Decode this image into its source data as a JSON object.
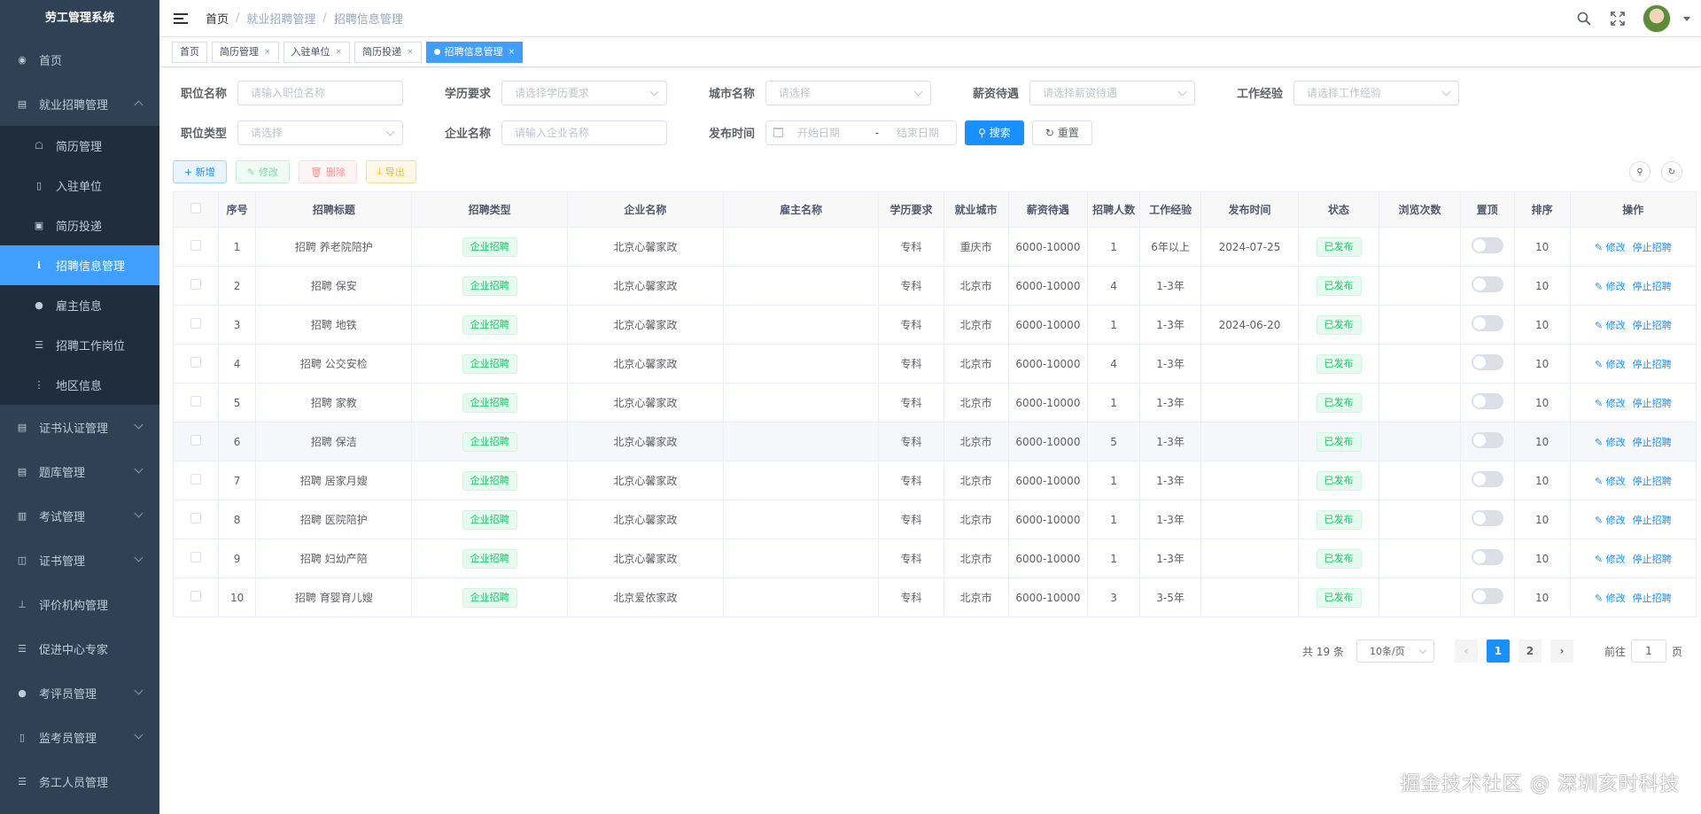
{
  "app": {
    "title": "劳工管理系统"
  },
  "sidebar": {
    "items": [
      {
        "label": "首页",
        "icon": "dashboard-icon"
      },
      {
        "label": "就业招聘管理",
        "icon": "document-icon",
        "expanded": true
      },
      {
        "label": "证书认证管理",
        "icon": "certificate-icon"
      },
      {
        "label": "题库管理",
        "icon": "book-icon"
      },
      {
        "label": "考试管理",
        "icon": "exam-icon"
      },
      {
        "label": "证书管理",
        "icon": "card-icon"
      },
      {
        "label": "评价机构管理",
        "icon": "tree-icon"
      },
      {
        "label": "促进中心专家",
        "icon": "list-icon"
      },
      {
        "label": "考评员管理",
        "icon": "user-icon"
      },
      {
        "label": "监考员管理",
        "icon": "monitor-icon"
      },
      {
        "label": "务工人员管理",
        "icon": "list-icon"
      }
    ],
    "sub_items": [
      {
        "label": "简历管理",
        "icon": "resume-icon"
      },
      {
        "label": "入驻单位",
        "icon": "building-icon"
      },
      {
        "label": "简历投递",
        "icon": "send-icon"
      },
      {
        "label": "招聘信息管理",
        "icon": "info-icon",
        "active": true
      },
      {
        "label": "雇主信息",
        "icon": "user-icon"
      },
      {
        "label": "招聘工作岗位",
        "icon": "list-icon"
      },
      {
        "label": "地区信息",
        "icon": "tree-icon"
      }
    ]
  },
  "navbar": {
    "breadcrumb": [
      "首页",
      "就业招聘管理",
      "招聘信息管理"
    ]
  },
  "tags": [
    {
      "label": "首页",
      "closable": false
    },
    {
      "label": "简历管理",
      "closable": true
    },
    {
      "label": "入驻单位",
      "closable": true
    },
    {
      "label": "简历投递",
      "closable": true
    },
    {
      "label": "招聘信息管理",
      "closable": true,
      "active": true
    }
  ],
  "search": {
    "position_name": {
      "label": "职位名称",
      "placeholder": "请输入职位名称"
    },
    "education": {
      "label": "学历要求",
      "placeholder": "请选择学历要求"
    },
    "city": {
      "label": "城市名称",
      "placeholder": "请选择"
    },
    "salary": {
      "label": "薪资待遇",
      "placeholder": "请选择薪资待遇"
    },
    "experience": {
      "label": "工作经验",
      "placeholder": "请选择工作经验"
    },
    "position_type": {
      "label": "职位类型",
      "placeholder": "请选择"
    },
    "company": {
      "label": "企业名称",
      "placeholder": "请输入企业名称"
    },
    "publish_time": {
      "label": "发布时间",
      "start_placeholder": "开始日期",
      "separator": "-",
      "end_placeholder": "结束日期"
    },
    "search_button": "搜索",
    "reset_button": "重置"
  },
  "toolbar": {
    "add": "+ 新增",
    "edit": "修改",
    "delete": "删除",
    "export": "导出"
  },
  "table": {
    "columns": [
      "序号",
      "招聘标题",
      "招聘类型",
      "企业名称",
      "雇主名称",
      "学历要求",
      "就业城市",
      "薪资待遇",
      "招聘人数",
      "工作经验",
      "发布时间",
      "状态",
      "浏览次数",
      "置顶",
      "排序",
      "操作"
    ],
    "rows": [
      {
        "no": "1",
        "title": "招聘 养老院陪护",
        "type": "企业招聘",
        "company": "北京心馨家政",
        "employer": "",
        "edu": "专科",
        "city": "重庆市",
        "salary": "6000-10000",
        "count": "1",
        "exp": "6年以上",
        "date": "2024-07-25",
        "status": "已发布",
        "views": "",
        "sort": "10"
      },
      {
        "no": "2",
        "title": "招聘 保安",
        "type": "企业招聘",
        "company": "北京心馨家政",
        "employer": "",
        "edu": "专科",
        "city": "北京市",
        "salary": "6000-10000",
        "count": "4",
        "exp": "1-3年",
        "date": "",
        "status": "已发布",
        "views": "",
        "sort": "10"
      },
      {
        "no": "3",
        "title": "招聘 地铁",
        "type": "企业招聘",
        "company": "北京心馨家政",
        "employer": "",
        "edu": "专科",
        "city": "北京市",
        "salary": "6000-10000",
        "count": "1",
        "exp": "1-3年",
        "date": "2024-06-20",
        "status": "已发布",
        "views": "",
        "sort": "10"
      },
      {
        "no": "4",
        "title": "招聘 公交安检",
        "type": "企业招聘",
        "company": "北京心馨家政",
        "employer": "",
        "edu": "专科",
        "city": "北京市",
        "salary": "6000-10000",
        "count": "4",
        "exp": "1-3年",
        "date": "",
        "status": "已发布",
        "views": "",
        "sort": "10"
      },
      {
        "no": "5",
        "title": "招聘 家教",
        "type": "企业招聘",
        "company": "北京心馨家政",
        "employer": "",
        "edu": "专科",
        "city": "北京市",
        "salary": "6000-10000",
        "count": "1",
        "exp": "1-3年",
        "date": "",
        "status": "已发布",
        "views": "",
        "sort": "10"
      },
      {
        "no": "6",
        "title": "招聘 保洁",
        "type": "企业招聘",
        "company": "北京心馨家政",
        "employer": "",
        "edu": "专科",
        "city": "北京市",
        "salary": "6000-10000",
        "count": "5",
        "exp": "1-3年",
        "date": "",
        "status": "已发布",
        "views": "",
        "sort": "10"
      },
      {
        "no": "7",
        "title": "招聘 居家月嫂",
        "type": "企业招聘",
        "company": "北京心馨家政",
        "employer": "",
        "edu": "专科",
        "city": "北京市",
        "salary": "6000-10000",
        "count": "1",
        "exp": "1-3年",
        "date": "",
        "status": "已发布",
        "views": "",
        "sort": "10"
      },
      {
        "no": "8",
        "title": "招聘 医院陪护",
        "type": "企业招聘",
        "company": "北京心馨家政",
        "employer": "",
        "edu": "专科",
        "city": "北京市",
        "salary": "6000-10000",
        "count": "1",
        "exp": "1-3年",
        "date": "",
        "status": "已发布",
        "views": "",
        "sort": "10"
      },
      {
        "no": "9",
        "title": "招聘 妇幼产陪",
        "type": "企业招聘",
        "company": "北京心馨家政",
        "employer": "",
        "edu": "专科",
        "city": "北京市",
        "salary": "6000-10000",
        "count": "1",
        "exp": "1-3年",
        "date": "",
        "status": "已发布",
        "views": "",
        "sort": "10"
      },
      {
        "no": "10",
        "title": "招聘 育婴育儿嫂",
        "type": "企业招聘",
        "company": "北京爱依家政",
        "employer": "",
        "edu": "专科",
        "city": "北京市",
        "salary": "6000-10000",
        "count": "3",
        "exp": "3-5年",
        "date": "",
        "status": "已发布",
        "views": "",
        "sort": "10"
      }
    ],
    "row_actions": {
      "edit": "修改",
      "stop": "停止招聘"
    }
  },
  "pagination": {
    "total": "共 19 条",
    "page_size": "10条/页",
    "pages": [
      "1",
      "2"
    ],
    "current": "1",
    "goto_label": "前往",
    "goto_value": "1",
    "goto_suffix": "页"
  },
  "watermark": "掘金技术社区 @ 深圳亥时科技",
  "colors": {
    "sidebar_bg": "#304156",
    "submenu_bg": "#1f2d3d",
    "primary": "#1890ff",
    "success": "#13ce66"
  }
}
